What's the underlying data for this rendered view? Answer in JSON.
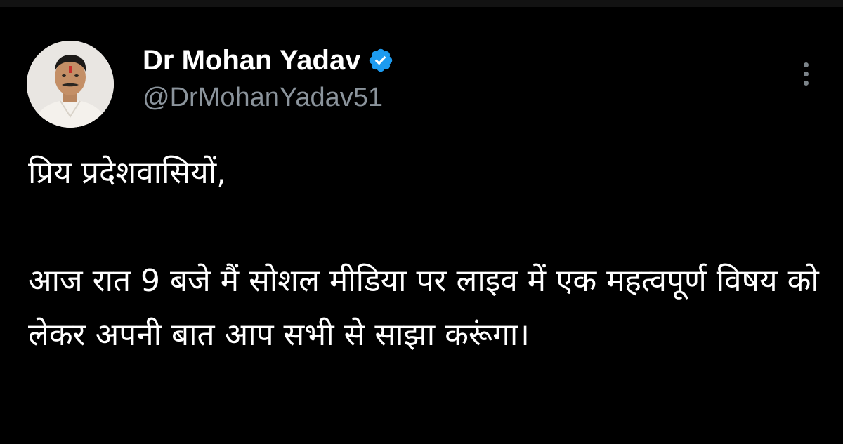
{
  "tweet": {
    "author": {
      "display_name": "Dr Mohan Yadav",
      "handle": "@DrMohanYadav51",
      "verified": true,
      "avatar_icon": "profile-photo"
    },
    "greeting": "प्रिय प्रदेशवासियों,",
    "body": "आज रात 9 बजे मैं सोशल मीडिया पर लाइव में एक महत्वपूर्ण विषय को लेकर अपनी बात आप सभी से साझा करूंगा।",
    "menu_icon": "more-vertical-icon"
  },
  "colors": {
    "background": "#000000",
    "text_primary": "#ffffff",
    "text_secondary": "#8b949c",
    "verified_badge": "#1d9bf0"
  }
}
